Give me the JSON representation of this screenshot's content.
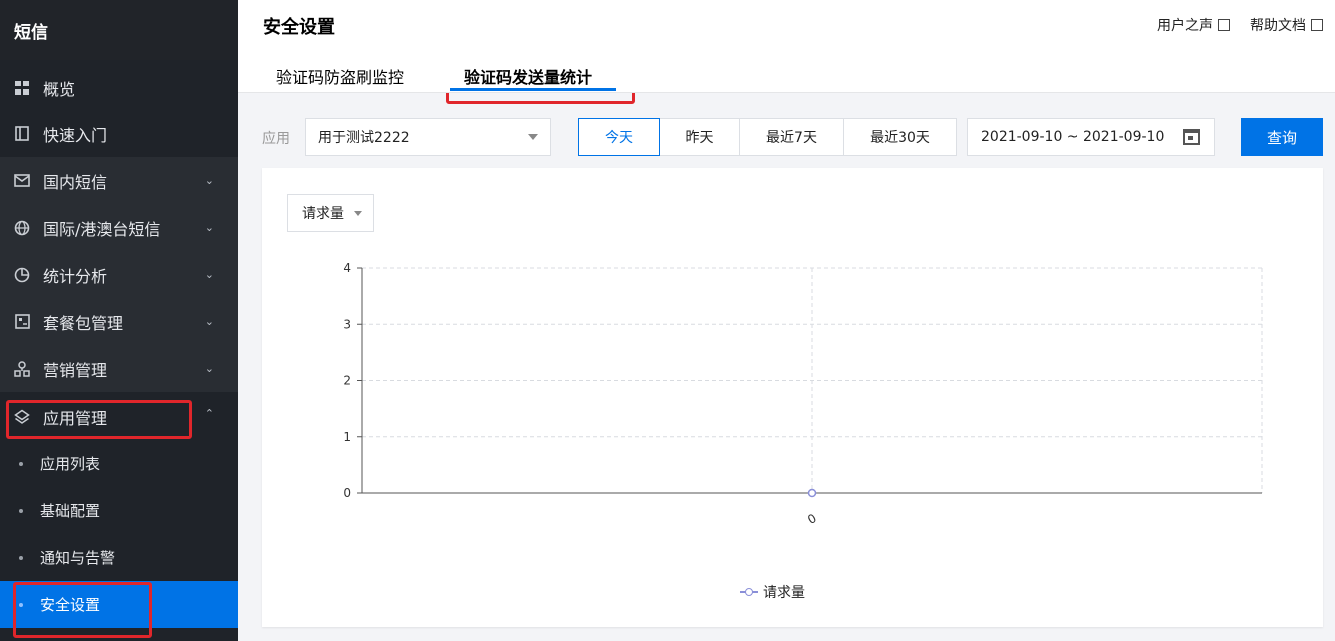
{
  "sidebar": {
    "title": "短信",
    "items": [
      {
        "label": "概览",
        "icon": "grid-icon"
      },
      {
        "label": "快速入门",
        "icon": "book-icon"
      },
      {
        "label": "国内短信",
        "icon": "mail-icon"
      },
      {
        "label": "国际/港澳台短信",
        "icon": "globe-icon"
      },
      {
        "label": "统计分析",
        "icon": "pie-chart-icon"
      },
      {
        "label": "套餐包管理",
        "icon": "package-icon"
      },
      {
        "label": "营销管理",
        "icon": "users-icon"
      },
      {
        "label": "应用管理",
        "icon": "layers-icon"
      }
    ],
    "sub_items": [
      {
        "label": "应用列表"
      },
      {
        "label": "基础配置"
      },
      {
        "label": "通知与告警"
      },
      {
        "label": "安全设置"
      }
    ]
  },
  "header": {
    "title": "安全设置",
    "links": [
      "用户之声",
      "帮助文档"
    ],
    "tabs": [
      "验证码防盗刷监控",
      "验证码发送量统计"
    ]
  },
  "filters": {
    "app_label": "应用",
    "app_value": "用于测试2222",
    "ranges": [
      "今天",
      "昨天",
      "最近7天",
      "最近30天"
    ],
    "date_range": "2021-09-10 ~ 2021-09-10",
    "query_label": "查询"
  },
  "chart": {
    "metric_select": "请求量",
    "legend": "请求量",
    "series_color": "#8a8fd8"
  },
  "chart_data": {
    "type": "line",
    "x": [
      "0"
    ],
    "series": [
      {
        "name": "请求量",
        "values": [
          0
        ]
      }
    ],
    "yticks": [
      0,
      1,
      2,
      3,
      4
    ],
    "ylim": [
      0,
      4
    ],
    "grid": true,
    "legend_position": "bottom"
  }
}
